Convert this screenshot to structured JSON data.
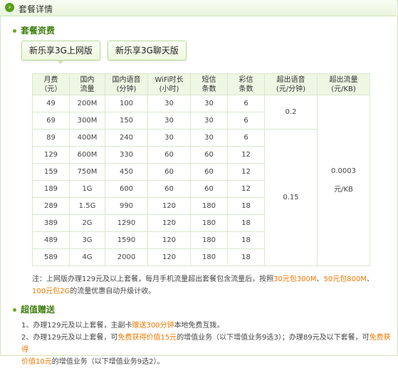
{
  "header": {
    "title": "套餐详情",
    "icon": "chevron-right-icon"
  },
  "section1": {
    "title": "套餐资费"
  },
  "tabs": [
    {
      "label": "新乐享3G上网版"
    },
    {
      "label": "新乐享3G聊天版"
    }
  ],
  "table": {
    "headers": [
      [
        "月费",
        "（元）"
      ],
      [
        "国内",
        "流量"
      ],
      [
        "国内语音",
        "(分钟)"
      ],
      [
        "WiFi时长",
        "(小时)"
      ],
      [
        "短信",
        "条数"
      ],
      [
        "彩信",
        "条数"
      ],
      [
        "超出语音",
        "(元/分钟)"
      ],
      [
        "超出流量",
        "(元/KB)"
      ]
    ],
    "rows": [
      [
        "49",
        "200M",
        "100",
        "30",
        "30",
        "6"
      ],
      [
        "69",
        "300M",
        "150",
        "30",
        "30",
        "6"
      ],
      [
        "89",
        "400M",
        "240",
        "30",
        "30",
        "6"
      ],
      [
        "129",
        "600M",
        "330",
        "60",
        "60",
        "12"
      ],
      [
        "159",
        "750M",
        "450",
        "60",
        "60",
        "12"
      ],
      [
        "189",
        "1G",
        "600",
        "60",
        "60",
        "12"
      ],
      [
        "289",
        "1.5G",
        "990",
        "120",
        "180",
        "18"
      ],
      [
        "389",
        "2G",
        "1290",
        "120",
        "180",
        "18"
      ],
      [
        "489",
        "3G",
        "1590",
        "120",
        "180",
        "18"
      ],
      [
        "589",
        "4G",
        "2000",
        "120",
        "180",
        "18"
      ]
    ],
    "voice_overage_a": "0.2",
    "voice_overage_b": "0.15",
    "data_overage_line1": "0.0003",
    "data_overage_line2": "元/KB"
  },
  "note": {
    "prefix": "注：上网版办理129元及以上套餐，每月手机流量超出套餐包含流量后，按照",
    "p1": "30元包300M",
    "sep1": "、",
    "p2": "50元包800M",
    "sep2": "、",
    "p3": "100元包2G",
    "suffix": "的流量优惠自动升级计收。"
  },
  "section2": {
    "title": "超值赠送"
  },
  "gifts": {
    "g1_prefix": "1、办理129元及以上套餐，主副卡",
    "g1_highlight": "赠送300分钟",
    "g1_suffix": "本地免费互拨。",
    "g2_prefix": "2、办理129元及以上套餐，可",
    "g2_highlight1": "免费获得价值15元",
    "g2_mid": "的增值业务（以下增值业务9选3）；办理89元及以下套餐，可",
    "g2_highlight2": "免费获得",
    "g2_highlight3": "价值10元",
    "g2_suffix": "的增值业务（以下增值业务9选2）。"
  },
  "colors": {
    "accent_green": "#3f7f0f",
    "highlight_orange": "#f07800",
    "header_bg": "#eef6e4"
  }
}
